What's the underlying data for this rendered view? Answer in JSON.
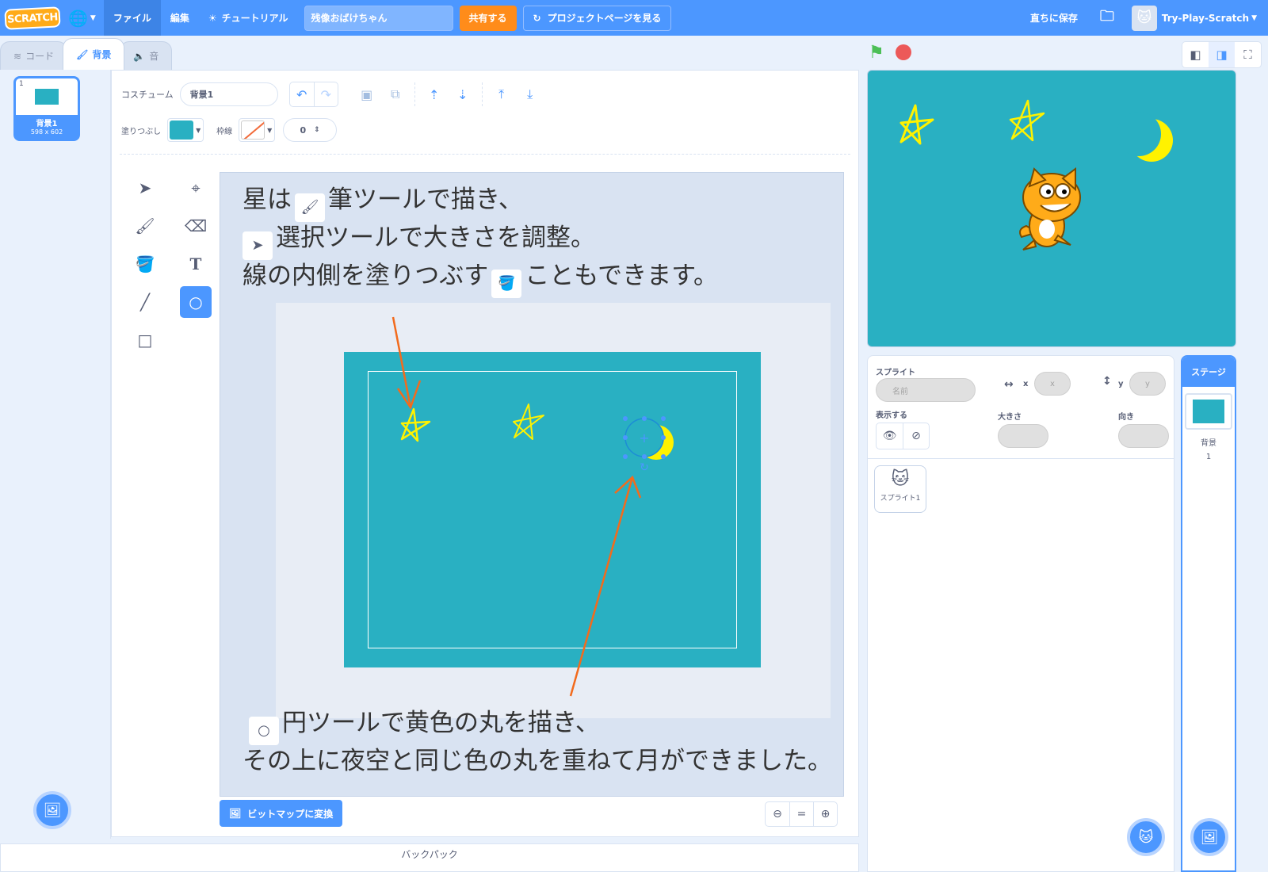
{
  "menubar": {
    "logo": "SCRATCH",
    "file": "ファイル",
    "edit": "編集",
    "tutorials": "チュートリアル",
    "project_title": "残像おばけちゃん",
    "share": "共有する",
    "see_project_page": "プロジェクトページを見る",
    "save_now": "直ちに保存",
    "username": "Try-Play-Scratch"
  },
  "tabs": {
    "code": "コード",
    "backdrops": "背景",
    "sounds": "音"
  },
  "costume_list": {
    "index": "1",
    "name": "背景1",
    "size": "598 x 602"
  },
  "paint": {
    "costume_label": "コスチューム",
    "costume_name": "背景1",
    "fill_label": "塗りつぶし",
    "outline_label": "枠線",
    "stroke_width": "0",
    "fill_color": "#29b0c2",
    "convert_button": "ビットマップに変換"
  },
  "annotation": {
    "line1_a": "星は",
    "line1_b": "筆ツールで描き、",
    "line2": "選択ツールで大きさを調整。",
    "line3_a": "線の内側を塗りつぶす",
    "line3_b": "こともできます。",
    "line4": "円ツールで黄色の丸を描き、",
    "line5": "その上に夜空と同じ色の丸を重ねて月ができました。"
  },
  "backpack": "バックパック",
  "sprite_info": {
    "sprite_label": "スプライト",
    "name_placeholder": "名前",
    "x_label": "x",
    "x_placeholder": "x",
    "y_label": "y",
    "y_placeholder": "y",
    "show_label": "表示する",
    "size_label": "大きさ",
    "direction_label": "向き"
  },
  "sprites": [
    {
      "name": "スプライト1"
    }
  ],
  "stage_selector": {
    "header": "ステージ",
    "backdrops_label": "背景",
    "backdrop_count": "1"
  },
  "colors": {
    "accent": "#4c97ff",
    "share": "#ff8c1a",
    "backdrop": "#29b0c2",
    "star": "#fff200",
    "annotation_arrow": "#f26b1d"
  }
}
